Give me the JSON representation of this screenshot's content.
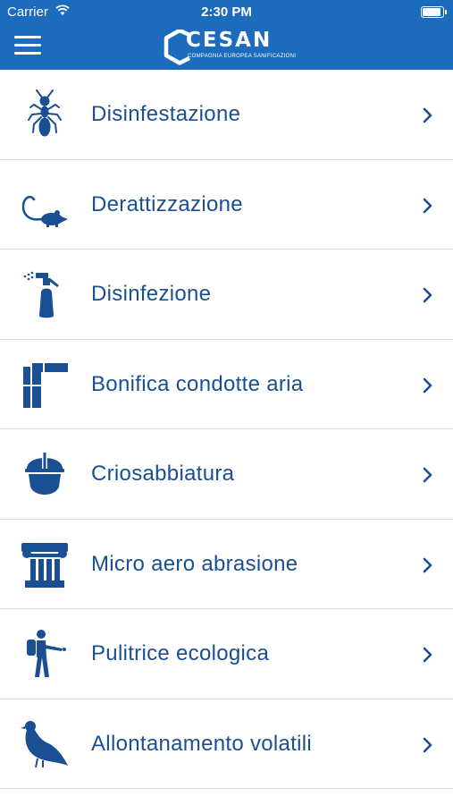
{
  "status_bar": {
    "carrier": "Carrier",
    "time": "2:30 PM"
  },
  "header": {
    "logo_name": "CESAN",
    "logo_tagline": "COMPAGNIA EUROPEA SANIFICAZIONI",
    "menu_icon": "hamburger-menu-icon",
    "background_color": "#1d6bbd"
  },
  "services": [
    {
      "label": "Disinfestazione",
      "icon": "ant-icon"
    },
    {
      "label": "Derattizzazione",
      "icon": "mouse-icon"
    },
    {
      "label": "Disinfezione",
      "icon": "spray-bottle-icon"
    },
    {
      "label": "Bonifica condotte aria",
      "icon": "air-duct-pipe-icon"
    },
    {
      "label": "Criosabbiatura",
      "icon": "hard-hat-icon"
    },
    {
      "label": "Micro aero abrasione",
      "icon": "column-icon"
    },
    {
      "label": "Pulitrice ecologica",
      "icon": "sprayer-worker-icon"
    },
    {
      "label": "Allontanamento volatili",
      "icon": "pigeon-icon"
    }
  ],
  "colors": {
    "accent": "#1d6bbd",
    "text": "#1a4f93",
    "divider": "#dcdcdc"
  }
}
